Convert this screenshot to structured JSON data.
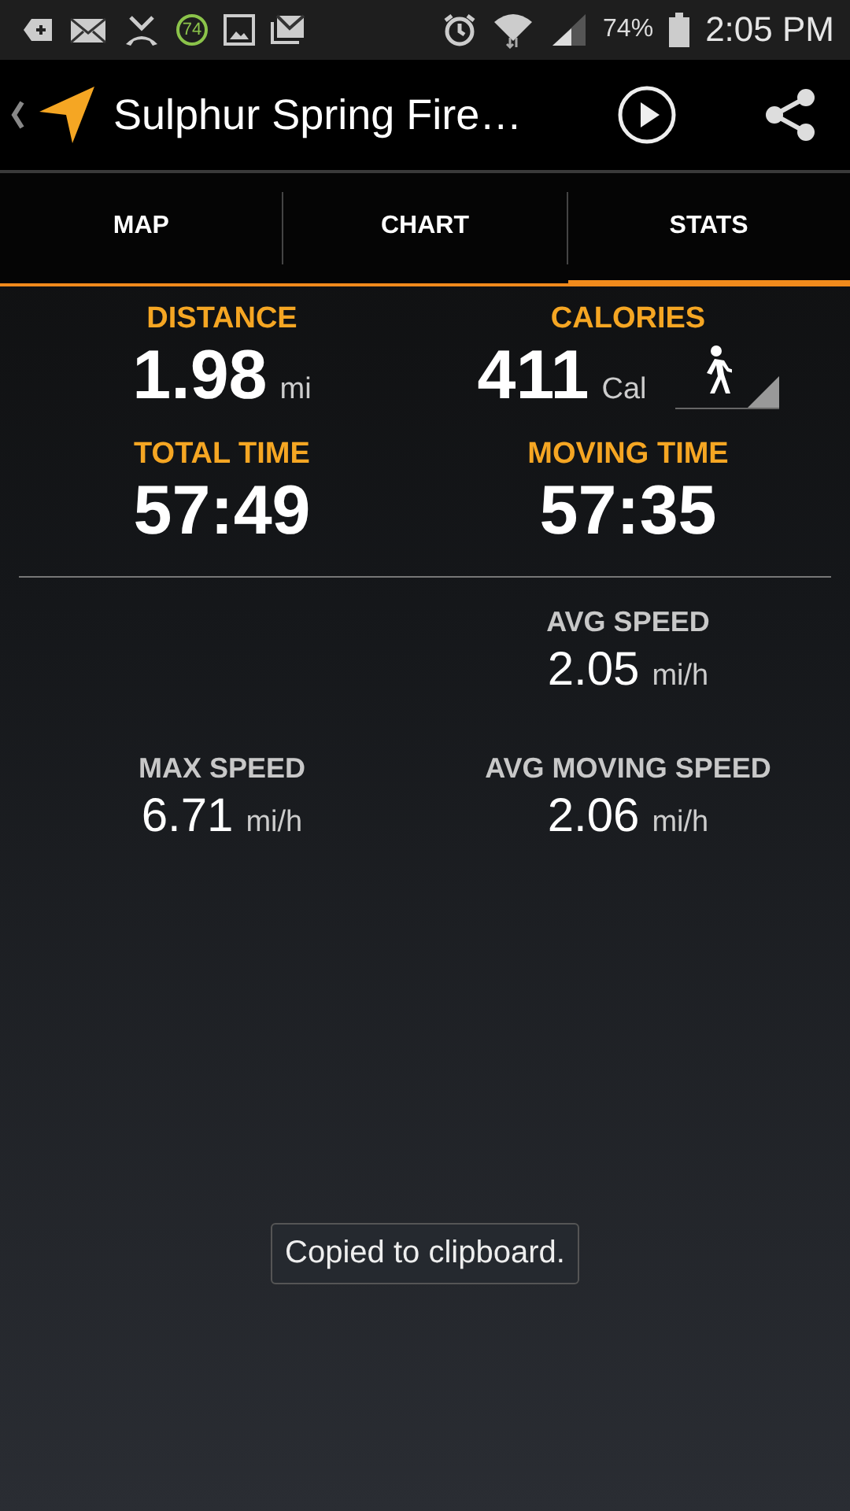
{
  "status_bar": {
    "notification_badge": "74",
    "battery": "74%",
    "time": "2:05 PM"
  },
  "app_bar": {
    "title": "Sulphur Spring Fire…"
  },
  "tabs": [
    {
      "label": "MAP",
      "selected": false
    },
    {
      "label": "CHART",
      "selected": false
    },
    {
      "label": "STATS",
      "selected": true
    }
  ],
  "stats": {
    "main": [
      {
        "left": {
          "label": "DISTANCE",
          "value": "1.98",
          "unit": "mi"
        },
        "right": {
          "label": "CALORIES",
          "value": "411",
          "unit": "Cal",
          "activity_selector": true
        }
      },
      {
        "left": {
          "label": "TOTAL TIME",
          "value": "57:49"
        },
        "right": {
          "label": "MOVING TIME",
          "value": "57:35"
        }
      }
    ],
    "speed": [
      {
        "right": {
          "label": "AVG SPEED",
          "value": "2.05",
          "unit": "mi/h"
        }
      },
      {
        "left": {
          "label": "MAX SPEED",
          "value": "6.71",
          "unit": "mi/h"
        },
        "right": {
          "label": "AVG MOVING SPEED",
          "value": "2.06",
          "unit": "mi/h"
        }
      }
    ]
  },
  "toast": "Copied to clipboard."
}
